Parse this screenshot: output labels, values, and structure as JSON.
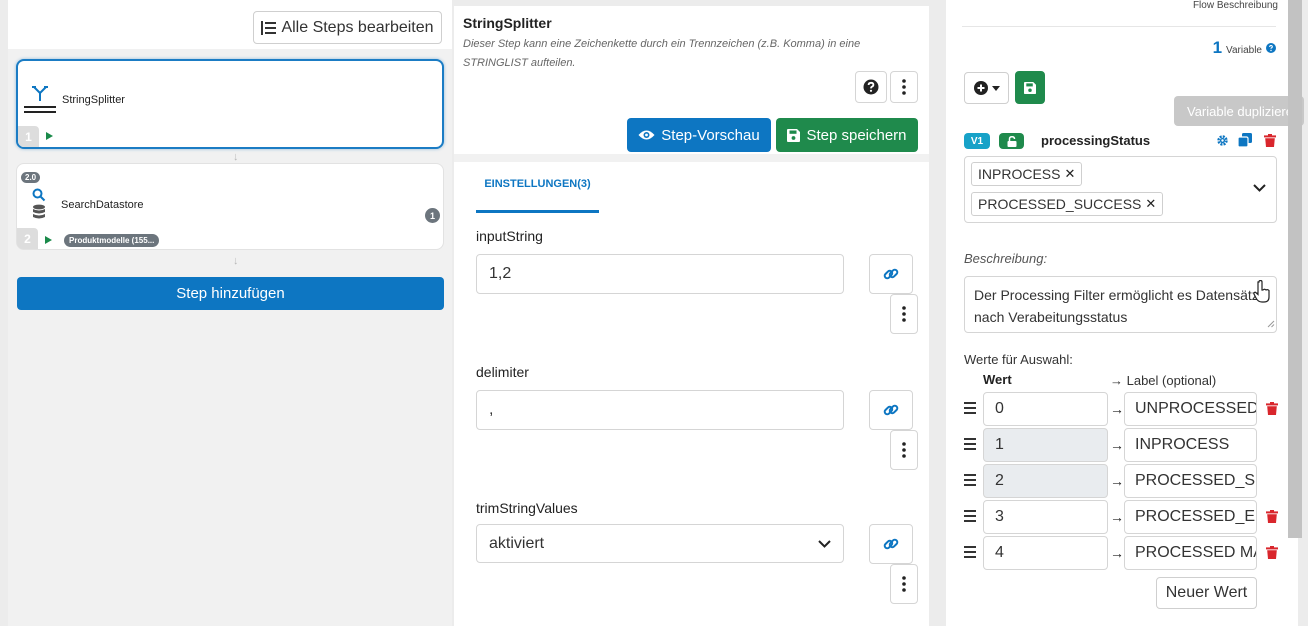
{
  "left_panel": {
    "edit_all_steps_label": "Alle Steps bearbeiten",
    "steps": [
      {
        "number": "1",
        "name": "StringSplitter"
      },
      {
        "number": "2",
        "name": "SearchDatastore",
        "version": "2.0",
        "count": "1",
        "tag": "Produktmodelle (155..."
      }
    ],
    "add_step_label": "Step hinzufügen"
  },
  "step_editor": {
    "title": "StringSplitter",
    "description": "Dieser Step kann eine Zeichenkette durch ein Trennzeichen (z.B. Komma) in eine STRINGLIST aufteilen.",
    "preview_label": "Step-Vorschau",
    "save_label": "Step speichern",
    "tab_label": "EINSTELLUNGEN(3)",
    "fields": [
      {
        "label": "inputString",
        "value": "1,2"
      },
      {
        "label": "delimiter",
        "value": ","
      },
      {
        "label": "trimStringValues",
        "value": "aktiviert"
      }
    ]
  },
  "variables_panel": {
    "flow_description_label": "Flow Beschreibung",
    "variable_count": "1",
    "variable_count_label": "Variable",
    "tooltip": "Variable duplizieren",
    "variable": {
      "badge": "V1",
      "name": "processingStatus",
      "selected": [
        "INPROCESS",
        "PROCESSED_SUCCESS"
      ],
      "description_label": "Beschreibung:",
      "description": "Der Processing Filter ermöglicht es Datensätze nach Verabeitungsstatus",
      "values_label": "Werte für Auswahl:",
      "value_col": "Wert",
      "label_col": "→ Label (optional)",
      "values": [
        {
          "value": "0",
          "label": "UNPROCESSED",
          "readonly": false,
          "deletable": true
        },
        {
          "value": "1",
          "label": "INPROCESS",
          "readonly": true,
          "deletable": false
        },
        {
          "value": "2",
          "label": "PROCESSED_SUCCESS",
          "readonly": true,
          "deletable": false
        },
        {
          "value": "3",
          "label": "PROCESSED_ERROR",
          "readonly": false,
          "deletable": true
        },
        {
          "value": "4",
          "label": "PROCESSED MANUALLY",
          "readonly": false,
          "deletable": true
        }
      ],
      "new_value_label": "Neuer Wert"
    }
  },
  "colors": {
    "primary": "#0d76c2",
    "success": "#1f8a4c",
    "info": "#17a2c8",
    "danger": "#d9262c"
  }
}
